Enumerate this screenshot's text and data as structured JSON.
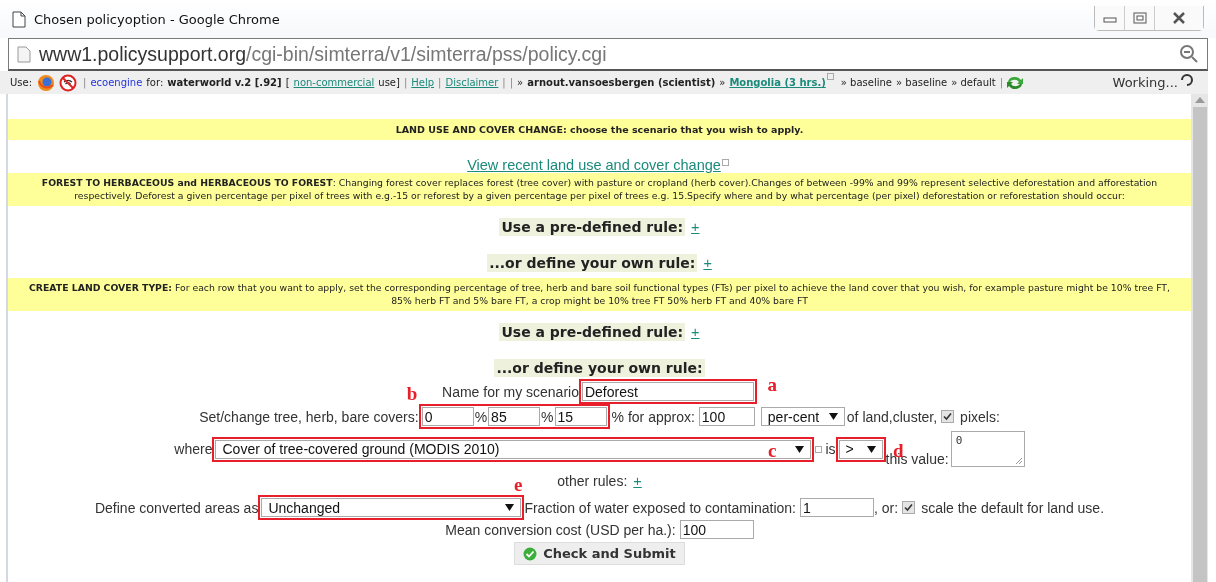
{
  "window": {
    "title": "Chosen policyoption - Google Chrome"
  },
  "address_bar": {
    "domain": "www1.policysupport.org",
    "path": "/cgi-bin/simterra/v1/simterra/pss/policy.cgi"
  },
  "toolbar": {
    "lead": "Use:",
    "segments": [
      {
        "text": "|",
        "kind": "sep"
      },
      {
        "text": "ecoengine",
        "kind": "brand"
      },
      {
        "text": "for:",
        "kind": "plain"
      },
      {
        "text": "waterworld v.2 [.92]",
        "kind": "bold"
      },
      {
        "text": "[",
        "kind": "plain"
      },
      {
        "text": "non-commercial",
        "kind": "link"
      },
      {
        "text": "use]",
        "kind": "plain"
      },
      {
        "text": "|",
        "kind": "sep"
      },
      {
        "text": "Help",
        "kind": "link"
      },
      {
        "text": "|",
        "kind": "sep"
      },
      {
        "text": "Disclaimer",
        "kind": "link"
      },
      {
        "text": "|",
        "kind": "sep"
      },
      {
        "text": "|",
        "kind": "sep"
      },
      {
        "text": "»",
        "kind": "plain"
      },
      {
        "text": "arnout.vansoesbergen (scientist)",
        "kind": "bold"
      },
      {
        "text": "»",
        "kind": "plain"
      },
      {
        "text": "Mongolia (3 hrs.)",
        "kind": "external"
      },
      {
        "text": "» baseline",
        "kind": "plain"
      },
      {
        "text": "» baseline",
        "kind": "plain"
      },
      {
        "text": "» default",
        "kind": "plain"
      },
      {
        "text": "|",
        "kind": "sep"
      }
    ],
    "status": "Working..."
  },
  "sections": [
    {
      "kind": "banner",
      "text": "LAND USE AND COVER CHANGE: choose the scenario that you wish to apply."
    },
    {
      "kind": "link",
      "text": "View recent land use and cover change"
    },
    {
      "kind": "info",
      "text": "**FOREST TO HERBACEOUS and HERBACEOUS TO FOREST**: Changing forest cover replaces forest (tree cover) with pasture or cropland (herb cover).Changes of between -99% and 99% represent selective deforestation and afforestation respectively. Deforest a given percentage per pixel of trees with e.g.-15 or reforest by a given percentage per pixel of trees e.g. 15.Specify where and by what percentage (per pixel) deforestation or reforestation should occur:"
    },
    {
      "kind": "rule",
      "text": "Use a pre-defined rule:",
      "link": "+"
    },
    {
      "kind": "rule",
      "text": "...or define your own rule:",
      "link": "+"
    },
    {
      "kind": "info",
      "text": "**CREATE LAND COVER TYPE:** For each row that you want to apply, set the corresponding percentage of tree, herb and bare soil functional types (FTs) per pixel to achieve the land cover that you wish, for example pasture might be 10% tree FT, 85% herb FT and 5% bare FT, a crop might be 10% tree FT 50% herb FT and 40% bare FT"
    },
    {
      "kind": "rule",
      "text": "Use a pre-defined rule:",
      "link": "+"
    },
    {
      "kind": "rule",
      "text": "...or define your own rule:"
    }
  ],
  "form": {
    "name_label": "Name for my scenario",
    "name_value": "Deforest",
    "covers_label": "Set/change tree, herb, bare covers:",
    "covers": [
      {
        "value": "0",
        "suffix": "%"
      },
      {
        "value": "85",
        "suffix": "%"
      },
      {
        "value": "15",
        "suffix": "% for approx:"
      }
    ],
    "approx_value": "100",
    "unit_select": "per-cent",
    "unit_suffix": "of land,cluster,",
    "pixels_checked": true,
    "pixels_label": "pixels:",
    "where_label": "where",
    "where_select": "Cover of tree-covered ground (MODIS 2010)",
    "is_label": "is",
    "operator": ">",
    "this_value_label": "this value:",
    "this_value": "0",
    "other_rules_label": "other rules:",
    "other_rules_link": "+",
    "converted_label": "Define converted areas as",
    "converted_select": "Unchanged",
    "fraction_label": "Fraction of water exposed to contamination:",
    "fraction_value": "1",
    "or_label": ", or:",
    "scale_checked": true,
    "scale_label": "scale the default for land use.",
    "cost_label": "Mean conversion cost (USD per ha.):",
    "cost_value": "100",
    "submit": "Check and Submit"
  },
  "annotations": {
    "name": "a",
    "covers": "b",
    "where": "c",
    "operator": "d",
    "converted": "e"
  }
}
